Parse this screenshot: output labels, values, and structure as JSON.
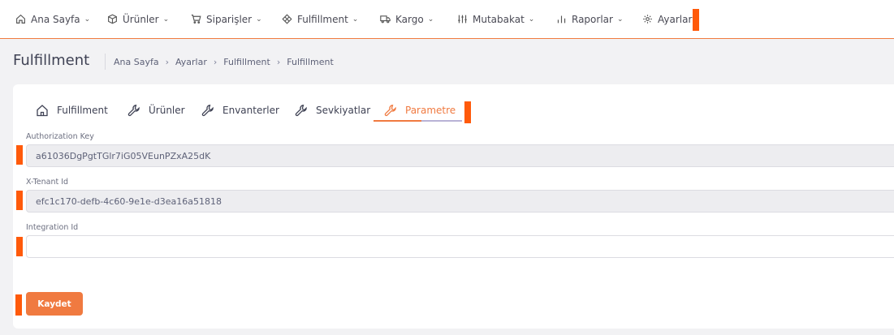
{
  "nav": {
    "items": [
      {
        "label": "Ana Sayfa",
        "icon": "home-icon"
      },
      {
        "label": "Ürünler",
        "icon": "box-icon"
      },
      {
        "label": "Siparişler",
        "icon": "cart-icon"
      },
      {
        "label": "Fulfillment",
        "icon": "cube-network-icon"
      },
      {
        "label": "Kargo",
        "icon": "truck-icon"
      },
      {
        "label": "Mutabakat",
        "icon": "sliders-icon"
      },
      {
        "label": "Raporlar",
        "icon": "bar-chart-icon"
      },
      {
        "label": "Ayarlar",
        "icon": "gear-icon"
      }
    ]
  },
  "header": {
    "title": "Fulfillment",
    "breadcrumb": [
      "Ana Sayfa",
      "Ayarlar",
      "Fulfillment",
      "Fulfillment"
    ]
  },
  "tabs": [
    {
      "label": "Fulfillment",
      "icon": "home-icon"
    },
    {
      "label": "Ürünler",
      "icon": "wrench-icon"
    },
    {
      "label": "Envanterler",
      "icon": "wrench-icon"
    },
    {
      "label": "Sevkiyatlar",
      "icon": "wrench-icon"
    },
    {
      "label": "Parametre",
      "icon": "wrench-icon",
      "active": true
    }
  ],
  "form": {
    "authorization_key": {
      "label": "Authorization Key",
      "value": "a61036DgPgtTGlr7iG05VEunPZxA25dK"
    },
    "tenant_id": {
      "label": "X-Tenant Id",
      "value": "efc1c170-defb-4c60-9e1e-d3ea16a51818"
    },
    "integration_id": {
      "label": "Integration Id",
      "value": ""
    },
    "save_label": "Kaydet"
  },
  "colors": {
    "accent": "#f07a40",
    "marker": "#ff5a0a"
  }
}
